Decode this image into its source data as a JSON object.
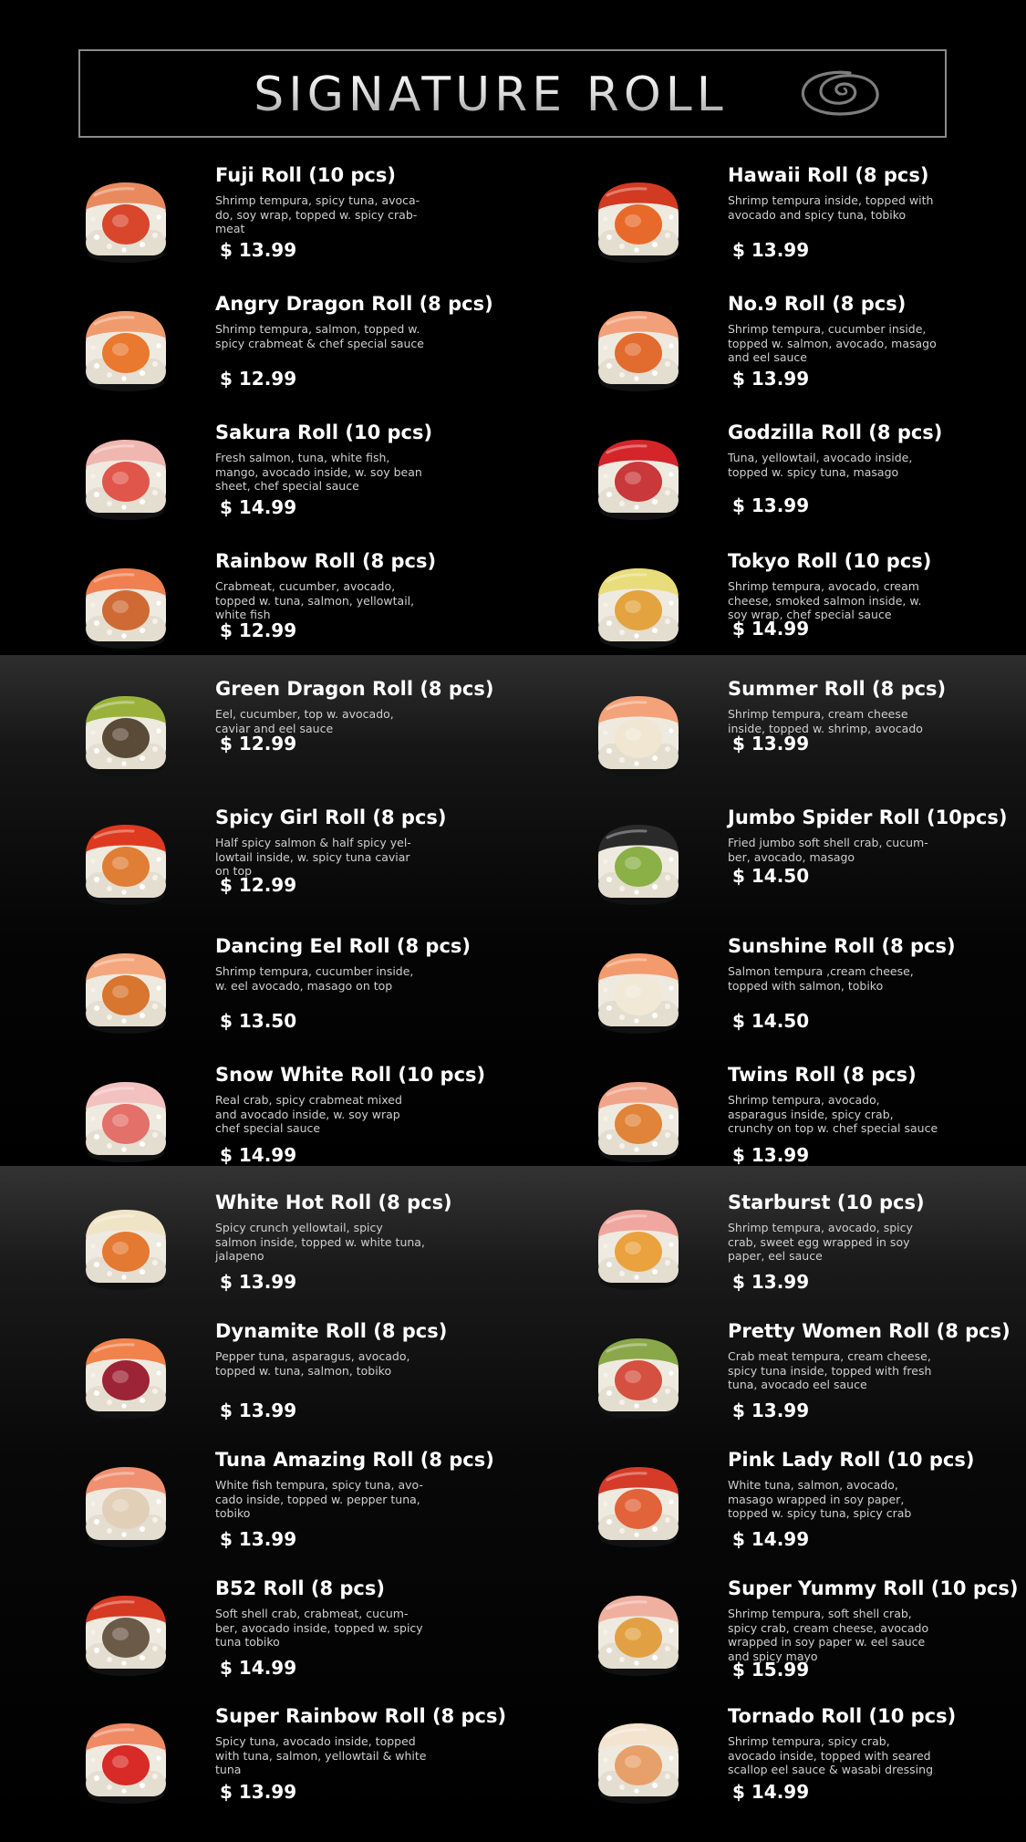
{
  "title": "SIGNATURE ROLL",
  "menu": [
    {
      "name": "Fuji Roll (10 pcs)",
      "desc": "Shrimp tempura, spicy tuna, avoca-do, soy wrap, topped w. spicy crab-meat",
      "price": "$ 13.99",
      "price_top": 72
    },
    {
      "name": "Hawaii Roll (8 pcs)",
      "desc": "Shrimp tempura inside, topped with avocado and spicy tuna, tobiko",
      "price": "$ 13.99",
      "price_top": 72
    },
    {
      "name": "Angry Dragon Roll (8 pcs)",
      "desc": "Shrimp tempura, salmon, topped w. spicy crabmeat & chef special sauce",
      "price": "$ 12.99",
      "price_top": 72
    },
    {
      "name": "No.9 Roll (8 pcs)",
      "desc": "Shrimp tempura, cucumber inside, topped w. salmon, avocado, masago and eel sauce",
      "price": "$ 13.99",
      "price_top": 72
    },
    {
      "name": "Sakura Roll (10 pcs)",
      "desc": "Fresh salmon, tuna, white fish, mango, avocado inside, w. soy bean sheet, chef special sauce",
      "price": "$ 14.99",
      "price_top": 72
    },
    {
      "name": "Godzilla Roll (8 pcs)",
      "desc": "Tuna, yellowtail, avocado inside, topped w. spicy tuna, masago",
      "price": "$ 13.99",
      "price_top": 70
    },
    {
      "name": "Rainbow Roll (8 pcs)",
      "desc": "Crabmeat, cucumber, avocado, topped w. tuna, salmon, yellowtail, white fish",
      "price": "$ 12.99",
      "price_top": 66
    },
    {
      "name": "Tokyo Roll (10 pcs)",
      "desc": "Shrimp tempura, avocado, cream cheese, smoked salmon inside, w. soy wrap, chef special sauce",
      "price": "$ 14.99",
      "price_top": 64
    },
    {
      "name": "Green Dragon Roll (8 pcs)",
      "desc": "Eel, cucumber, top w. avocado, caviar and eel sauce",
      "price": "$ 12.99",
      "price_top": 50
    },
    {
      "name": "Summer Roll (8 pcs)",
      "desc": "Shrimp tempura, cream cheese inside, topped w. shrimp, avocado",
      "price": "$ 13.99",
      "price_top": 50
    },
    {
      "name": "Spicy Girl Roll (8 pcs)",
      "desc": "Half spicy salmon & half spicy yel-lowtail inside, w. spicy tuna caviar on top",
      "price": "$ 12.99",
      "price_top": 64
    },
    {
      "name": "Jumbo Spider Roll (10pcs)",
      "desc": "Fried jumbo soft shell crab, cucum-ber, avocado, masago",
      "price": "$ 14.50",
      "price_top": 54
    },
    {
      "name": "Dancing Eel Roll (8 pcs)",
      "desc": "Shrimp tempura, cucumber inside, w. eel avocado, masago on top",
      "price": "$ 13.50",
      "price_top": 72
    },
    {
      "name": "Sunshine Roll (8 pcs)",
      "desc": "Salmon tempura ,cream cheese, topped with salmon, tobiko",
      "price": "$ 14.50",
      "price_top": 72
    },
    {
      "name": "Snow White Roll (10 pcs)",
      "desc": "Real crab, spicy crabmeat mixed and avocado inside, w. soy wrap chef special sauce",
      "price": "$ 14.99",
      "price_top": 78
    },
    {
      "name": "Twins Roll (8 pcs)",
      "desc": "Shrimp tempura, avocado, asparagus inside, spicy crab, crunchy on top w. chef special sauce",
      "price": "$ 13.99",
      "price_top": 78
    },
    {
      "name": "White Hot Roll (8 pcs)",
      "desc": "Spicy crunch yellowtail, spicy salmon inside, topped w. white tuna, jalapeno",
      "price": "$ 13.99",
      "price_top": 77
    },
    {
      "name": "Starburst (10 pcs)",
      "desc": "Shrimp tempura, avocado, spicy crab, sweet egg wrapped in soy paper, eel sauce",
      "price": "$ 13.99",
      "price_top": 77
    },
    {
      "name": "Dynamite Roll (8 pcs)",
      "desc": "Pepper tuna, asparagus, avocado, topped w. tuna, salmon, tobiko",
      "price": "$ 13.99",
      "price_top": 77
    },
    {
      "name": "Pretty Women Roll (8 pcs)",
      "desc": "Crab meat tempura, cream cheese, spicy tuna inside, topped with fresh tuna, avocado eel sauce",
      "price": "$ 13.99",
      "price_top": 77
    },
    {
      "name": "Tuna Amazing Roll (8 pcs)",
      "desc": "White fish tempura, spicy tuna, avo-cado inside, topped w. pepper tuna, tobiko",
      "price": "$ 13.99",
      "price_top": 77
    },
    {
      "name": "Pink Lady Roll (10 pcs)",
      "desc": "White tuna, salmon, avocado, masago wrapped in soy paper, topped w. spicy tuna, spicy crab",
      "price": "$ 14.99",
      "price_top": 77
    },
    {
      "name": "B52 Roll (8 pcs)",
      "desc": "Soft shell crab, crabmeat, cucum-ber, avocado inside, topped w. spicy tuna tobiko",
      "price": "$ 14.99",
      "price_top": 77
    },
    {
      "name": "Super Yummy Roll (10 pcs)",
      "desc": "Shrimp tempura, soft shell crab, spicy crab, cream cheese, avocado wrapped in soy paper w. eel sauce and spicy mayo",
      "price": "$ 15.99",
      "price_top": 79
    },
    {
      "name": "Super Rainbow Roll (8 pcs)",
      "desc": "Spicy tuna, avocado inside, topped with tuna, salmon, yellowtail & white tuna",
      "price": "$ 13.99",
      "price_top": 73
    },
    {
      "name": "Tornado Roll (10 pcs)",
      "desc": "Shrimp tempura, spicy crab, avocado inside, topped with seared scallop eel sauce & wasabi dressing",
      "price": "$ 14.99",
      "price_top": 73
    }
  ]
}
